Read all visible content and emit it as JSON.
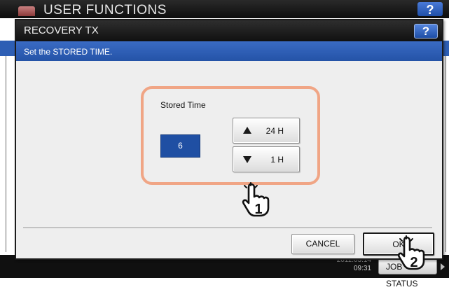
{
  "background": {
    "title": "USER FUNCTIONS",
    "help_label": "?",
    "clock": {
      "date": "2011.03.14",
      "time": "09:31"
    },
    "job_status_label": "JOB STATUS"
  },
  "dialog": {
    "title": "RECOVERY TX",
    "help_label": "?",
    "message": "Set the STORED TIME.",
    "stored_time": {
      "label": "Stored Time",
      "value": "6",
      "up_label": "24 H",
      "down_label": "1 H"
    },
    "cancel_label": "CANCEL",
    "ok_label": "OK"
  },
  "callouts": [
    {
      "number": "1",
      "target": "stored-time-control"
    },
    {
      "number": "2",
      "target": "ok-button"
    }
  ],
  "colors": {
    "accent_blue": "#2d5eb4",
    "value_box": "#1f4fa3",
    "highlight": "#f0a585"
  }
}
